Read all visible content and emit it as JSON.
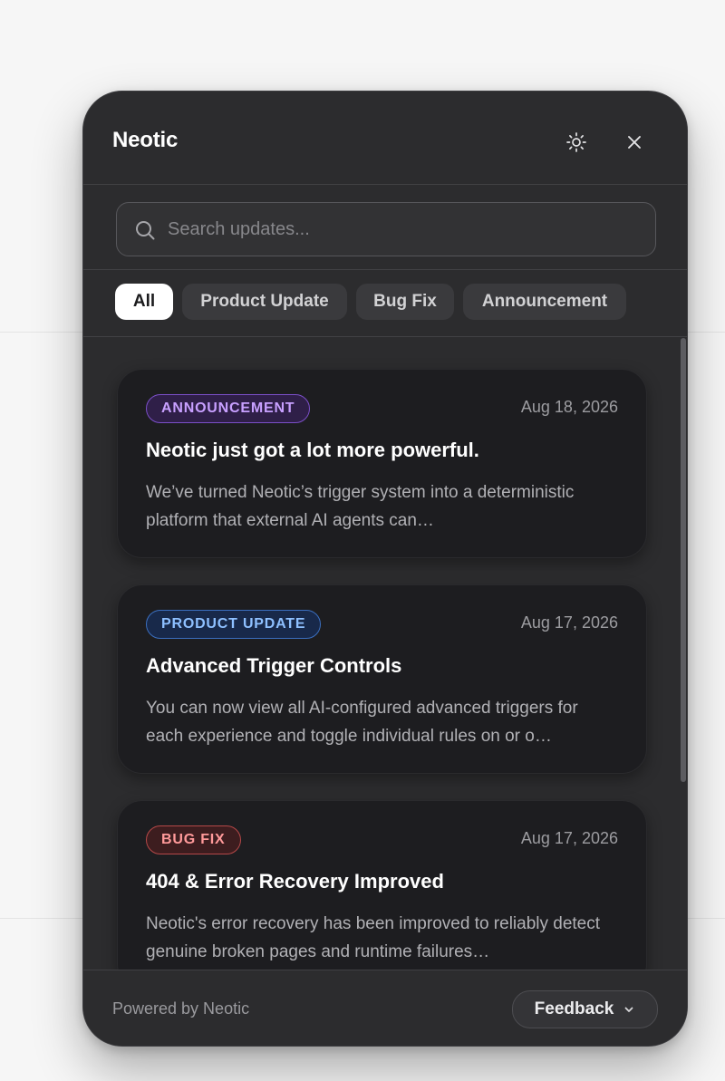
{
  "app": {
    "title": "Neotic"
  },
  "search": {
    "placeholder": "Search updates..."
  },
  "filters": [
    "All",
    "Product Update",
    "Bug Fix",
    "Announcement"
  ],
  "active_filter": "All",
  "updates": [
    {
      "badge": "ANNOUNCEMENT",
      "badge_colors": {
        "text": "#c8a0ff",
        "border": "#7b4fc8",
        "bg": "#2f1f48"
      },
      "date": "Aug 18, 2026",
      "title": "Neotic just got a lot more powerful.",
      "description": "We’ve turned Neotic’s trigger system into a deterministic platform that external AI agents can…"
    },
    {
      "badge": "PRODUCT UPDATE",
      "badge_colors": {
        "text": "#8ec0ff",
        "border": "#3b6fc0",
        "bg": "#18294a"
      },
      "date": "Aug 17, 2026",
      "title": "Advanced Trigger Controls",
      "description": "You can now view all AI-configured advanced triggers for each experience and toggle individual rules on or o…"
    },
    {
      "badge": "BUG FIX",
      "badge_colors": {
        "text": "#ff9a9a",
        "border": "#b54848",
        "bg": "#3d1d1f"
      },
      "date": "Aug 17, 2026",
      "title": "404 & Error Recovery Improved",
      "description": "Neotic's error recovery has been improved to reliably detect genuine broken pages and runtime failures…"
    }
  ],
  "footer": {
    "powered_by": "Powered by Neotic",
    "feedback_label": "Feedback"
  },
  "icons": {
    "theme": "sun-icon",
    "close": "close-icon",
    "search": "search-icon",
    "feedback_dropdown": "chevron-down-icon"
  }
}
